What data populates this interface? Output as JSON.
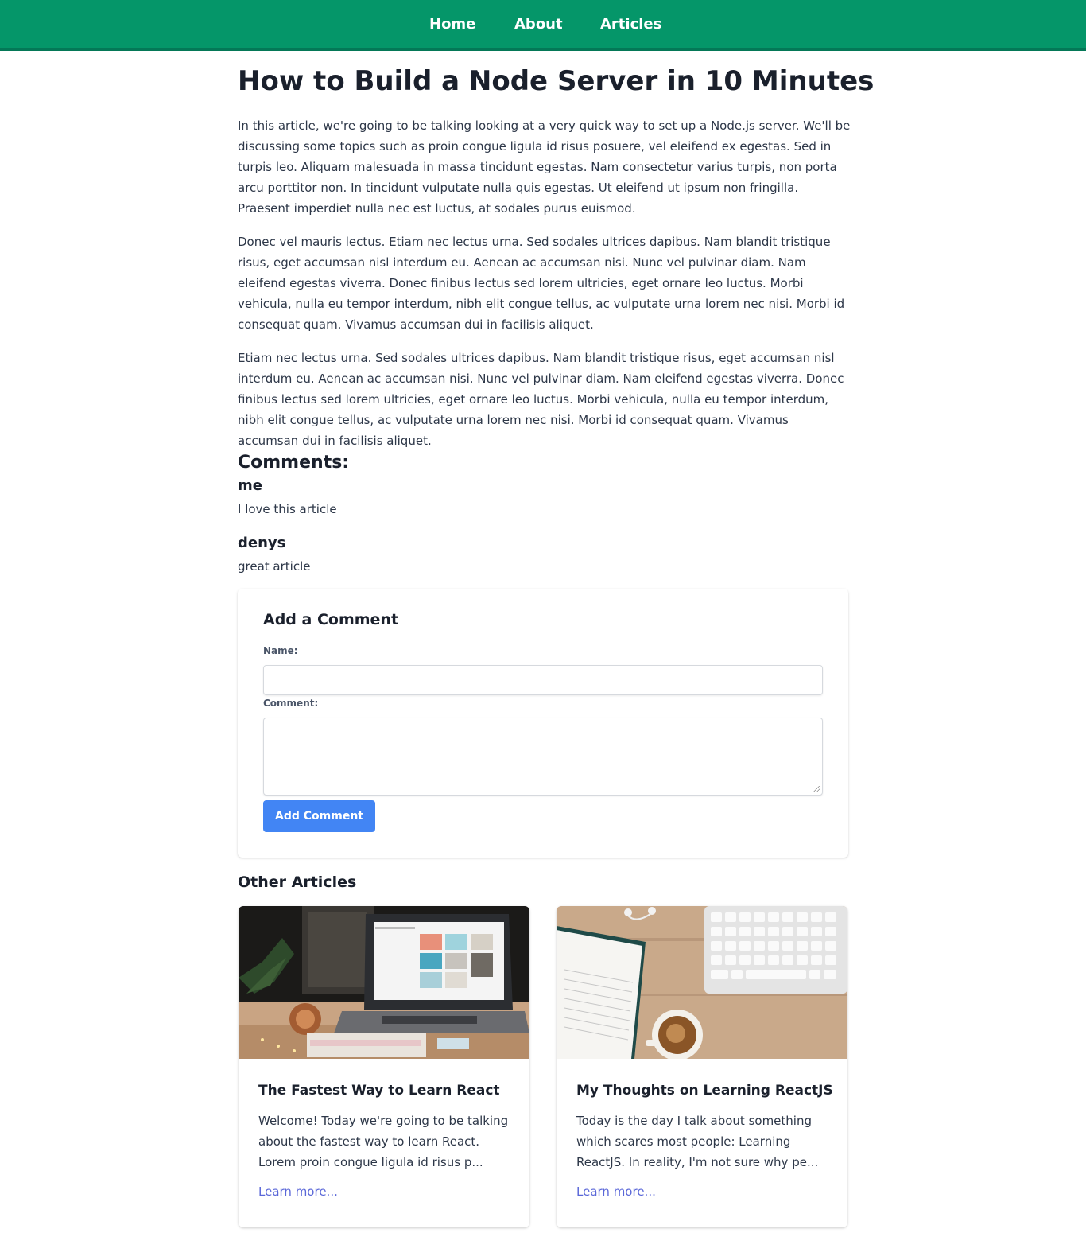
{
  "nav": {
    "home": "Home",
    "about": "About",
    "articles": "Articles"
  },
  "article": {
    "title": "How to Build a Node Server in 10 Minutes",
    "paragraphs": [
      "In this article, we're going to be talking looking at a very quick way to set up a Node.js server. We'll be discussing some topics such as proin congue ligula id risus posuere, vel eleifend ex egestas. Sed in turpis leo. Aliquam malesuada in massa tincidunt egestas. Nam consectetur varius turpis, non porta arcu porttitor non. In tincidunt vulputate nulla quis egestas. Ut eleifend ut ipsum non fringilla. Praesent imperdiet nulla nec est luctus, at sodales purus euismod.",
      "Donec vel mauris lectus. Etiam nec lectus urna. Sed sodales ultrices dapibus. Nam blandit tristique risus, eget accumsan nisl interdum eu. Aenean ac accumsan nisi. Nunc vel pulvinar diam. Nam eleifend egestas viverra. Donec finibus lectus sed lorem ultricies, eget ornare leo luctus. Morbi vehicula, nulla eu tempor interdum, nibh elit congue tellus, ac vulputate urna lorem nec nisi. Morbi id consequat quam. Vivamus accumsan dui in facilisis aliquet.",
      "Etiam nec lectus urna. Sed sodales ultrices dapibus. Nam blandit tristique risus, eget accumsan nisl interdum eu. Aenean ac accumsan nisi. Nunc vel pulvinar diam. Nam eleifend egestas viverra. Donec finibus lectus sed lorem ultricies, eget ornare leo luctus. Morbi vehicula, nulla eu tempor interdum, nibh elit congue tellus, ac vulputate urna lorem nec nisi. Morbi id consequat quam. Vivamus accumsan dui in facilisis aliquet."
    ]
  },
  "comments": {
    "heading": "Comments:",
    "items": [
      {
        "author": "me",
        "text": "I love this article"
      },
      {
        "author": "denys",
        "text": "great article"
      }
    ]
  },
  "form": {
    "title": "Add a Comment",
    "name_label": "Name:",
    "name_value": "",
    "comment_label": "Comment:",
    "comment_value": "",
    "submit_label": "Add Comment"
  },
  "other": {
    "heading": "Other Articles",
    "cards": [
      {
        "title": "The Fastest Way to Learn React",
        "excerpt": "Welcome! Today we're going to be talking about the fastest way to learn React. Lorem proin congue ligula id risus p...",
        "link": "Learn more..."
      },
      {
        "title": "My Thoughts on Learning ReactJS",
        "excerpt": "Today is the day I talk about something which scares most people: Learning ReactJS. In reality, I'm not sure why pe...",
        "link": "Learn more..."
      }
    ]
  },
  "colors": {
    "nav_bg": "#059669",
    "button_bg": "#4285f4",
    "link": "#5a67d8"
  }
}
